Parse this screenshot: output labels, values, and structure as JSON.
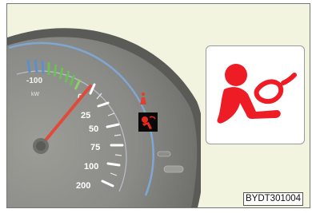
{
  "gauge": {
    "power_scale": [
      "-100",
      "0"
    ],
    "power_unit": "kW",
    "ticks": [
      "25",
      "50",
      "75",
      "100",
      "200"
    ]
  },
  "warning_lights": {
    "dash_airbag": "airbag-warning-icon",
    "dash_seatbelt": "seatbelt-warning-icon"
  },
  "callout": {
    "icon": "airbag-warning-icon",
    "color": "#ee1c25"
  },
  "figure_code": "BYDT301004"
}
